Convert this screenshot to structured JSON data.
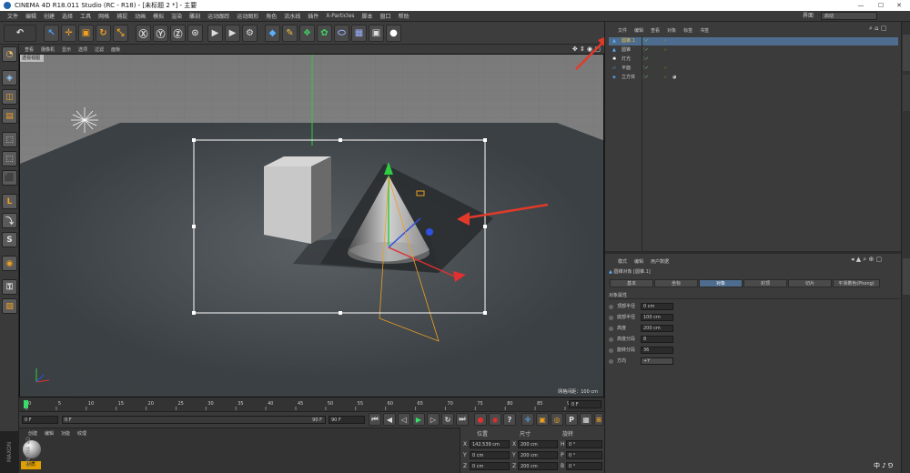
{
  "window": {
    "title": "CINEMA 4D R18.011 Studio (RC - R18) - [未标题 2 *] - 主要",
    "minimize": "—",
    "maximize": "☐",
    "close": "✕"
  },
  "menubar": {
    "items": [
      "文件",
      "编辑",
      "创建",
      "选择",
      "工具",
      "网格",
      "捕捉",
      "动画",
      "模拟",
      "渲染",
      "雕刻",
      "运动跟踪",
      "运动图形",
      "角色",
      "流水线",
      "插件",
      "X-Particles",
      "脚本",
      "窗口",
      "帮助"
    ],
    "layout_label": "界面",
    "layout_value": "启动"
  },
  "viewport": {
    "menu": [
      "查看",
      "摄像机",
      "显示",
      "选项",
      "过滤",
      "面板"
    ],
    "camera_label": "透视视图",
    "grid_info": "网格间距：100 cm",
    "nav_icons": "✥ ⇕ ◉ ▢"
  },
  "timeline": {
    "ticks": [
      "0",
      "5",
      "10",
      "15",
      "20",
      "25",
      "30",
      "35",
      "40",
      "45",
      "50",
      "55",
      "60",
      "65",
      "70",
      "75",
      "80",
      "85",
      "90"
    ],
    "frame_display": "0 F"
  },
  "transport": {
    "start": "0 F",
    "current": "0 F",
    "end": "90 F",
    "end2": "90 F"
  },
  "material": {
    "menu": [
      "创建",
      "编辑",
      "功能",
      "纹理"
    ],
    "name": "材质"
  },
  "coords": {
    "headers": [
      "位置",
      "尺寸",
      "旋转"
    ],
    "rows": [
      {
        "axis": "X",
        "pos": "142.539 cm",
        "size_axis": "X",
        "size": "200 cm",
        "rot_axis": "H",
        "rot": "0 °"
      },
      {
        "axis": "Y",
        "pos": "0 cm",
        "size_axis": "Y",
        "size": "200 cm",
        "rot_axis": "P",
        "rot": "0 °"
      },
      {
        "axis": "Z",
        "pos": "0 cm",
        "size_axis": "Z",
        "size": "200 cm",
        "rot_axis": "B",
        "rot": "0 °"
      }
    ]
  },
  "objects": {
    "menu": [
      "文件",
      "编辑",
      "查看",
      "对象",
      "标签",
      "书签"
    ],
    "items": [
      {
        "name": "圆锥.1",
        "selected": true
      },
      {
        "name": "圆锥",
        "selected": false
      },
      {
        "name": "灯光",
        "selected": false
      },
      {
        "name": "平面",
        "selected": false
      },
      {
        "name": "立方体",
        "selected": false
      }
    ]
  },
  "attributes": {
    "menu": [
      "模式",
      "编辑",
      "用户数据"
    ],
    "object_title": "圆锥对象 [圆锥.1]",
    "tabs": [
      "基本",
      "坐标",
      "对象",
      "封顶",
      "切片",
      "平滑着色(Phong)"
    ],
    "active_tab": "对象",
    "section": "对象属性",
    "props": [
      {
        "label": "顶部半径",
        "value": "0 cm"
      },
      {
        "label": "底部半径",
        "value": "100 cm"
      },
      {
        "label": "高度",
        "value": "200 cm"
      },
      {
        "label": "高度分段",
        "value": "8"
      },
      {
        "label": "旋转分段",
        "value": "36"
      },
      {
        "label": "方向",
        "value": "+Y"
      }
    ]
  },
  "ime": {
    "text": "中 ♪ ⅁"
  },
  "brand": {
    "text": "MAXON CINEMA 4D"
  },
  "colors": {
    "accent": "#e0a000",
    "selected": "#4d6c8e",
    "annotation_arrow": "#e23a2a",
    "selection_box": "#ffffff"
  }
}
